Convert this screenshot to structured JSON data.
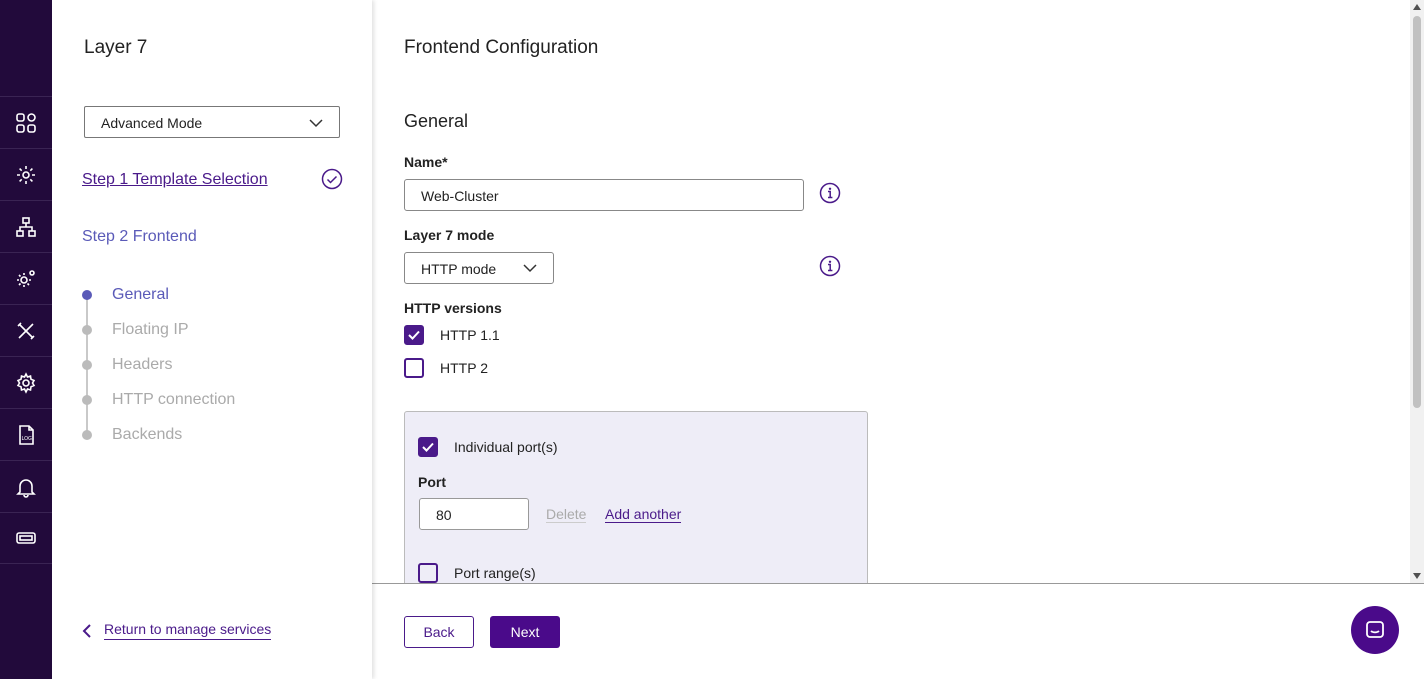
{
  "rail": {
    "icons": [
      "dashboard-icon",
      "virtual-services-icon",
      "network-icon",
      "settings-cogs-icon",
      "tools-icon",
      "gear-icon",
      "log-icon",
      "bell-icon",
      "ticket-icon"
    ],
    "log_icon_text": "LOG"
  },
  "panel": {
    "title": "Layer 7",
    "mode_select": "Advanced Mode",
    "step1": "Step 1 Template Selection",
    "step2": "Step 2 Frontend",
    "substeps": [
      "General",
      "Floating IP",
      "Headers",
      "HTTP connection",
      "Backends"
    ],
    "active_substep": "General",
    "return_link": "Return to manage services"
  },
  "main": {
    "title": "Frontend Configuration",
    "section": "General",
    "name_label": "Name*",
    "name_value": "Web-Cluster",
    "l7_mode_label": "Layer 7 mode",
    "l7_mode_value": "HTTP mode",
    "http_versions_label": "HTTP versions",
    "http11": {
      "label": "HTTP 1.1",
      "checked": true
    },
    "http2": {
      "label": "HTTP 2",
      "checked": false
    },
    "individual_ports": {
      "label": "Individual port(s)",
      "checked": true
    },
    "port_label": "Port",
    "port_value": "80",
    "delete_link": "Delete",
    "add_another_link": "Add another",
    "port_ranges": {
      "label": "Port range(s)",
      "checked": false
    }
  },
  "footer": {
    "back_label": "Back",
    "next_label": "Next"
  },
  "colors": {
    "rail_bg": "#220a3b",
    "brand": "#4a0a8a",
    "step_accent": "#5a5ab8",
    "port_box_bg": "#eeedf7"
  }
}
